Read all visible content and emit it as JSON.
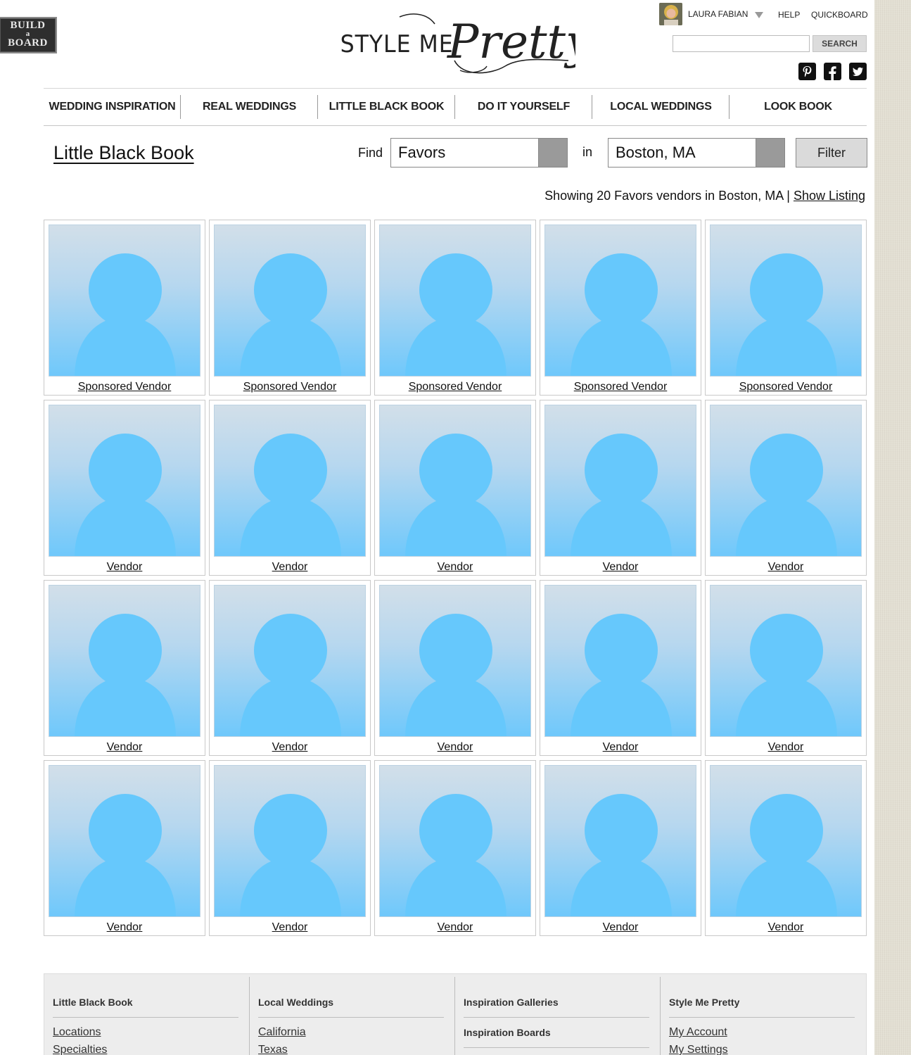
{
  "build_board": {
    "line1": "BUILD",
    "line2": "a",
    "line3": "BOARD"
  },
  "logo": {
    "text_left": "STYLE ME",
    "text_script": "Pretty"
  },
  "header": {
    "user_name": "LAURA FABIAN",
    "help": "HELP",
    "quickboard": "QUICKBOARD",
    "search_placeholder": "",
    "search_button": "SEARCH",
    "social": [
      "pinterest-icon",
      "facebook-icon",
      "twitter-icon"
    ]
  },
  "nav": [
    "WEDDING INSPIRATION",
    "REAL WEDDINGS",
    "LITTLE BLACK BOOK",
    "DO IT YOURSELF",
    "LOCAL WEDDINGS",
    "LOOK BOOK"
  ],
  "filter_bar": {
    "title": "Little Black Book",
    "find_label": "Find",
    "category": "Favors",
    "in_label": "in",
    "location": "Boston, MA",
    "filter_button": "Filter"
  },
  "results": {
    "summary": "Showing 20 Favors vendors in Boston, MA |",
    "show_listing": "Show Listing"
  },
  "vendors": [
    "Sponsored Vendor",
    "Sponsored Vendor",
    "Sponsored Vendor",
    "Sponsored Vendor",
    "Sponsored Vendor",
    "Vendor",
    "Vendor",
    "Vendor",
    "Vendor",
    "Vendor",
    "Vendor",
    "Vendor",
    "Vendor",
    "Vendor",
    "Vendor",
    "Vendor",
    "Vendor",
    "Vendor",
    "Vendor",
    "Vendor"
  ],
  "footer": {
    "col1": {
      "heading": "Little Black Book",
      "links": [
        "Locations",
        "Specialties"
      ]
    },
    "col2": {
      "heading": "Local Weddings",
      "links": [
        "California",
        "Texas"
      ]
    },
    "col3": {
      "heading": "Inspiration Galleries",
      "heading2": "Inspiration Boards"
    },
    "col4": {
      "heading": "Style Me Pretty",
      "links": [
        "My Account",
        "My Settings"
      ]
    }
  },
  "colors": {
    "placeholder_blue": "#66c8fc",
    "nav_divider": "#9a9a9a"
  }
}
